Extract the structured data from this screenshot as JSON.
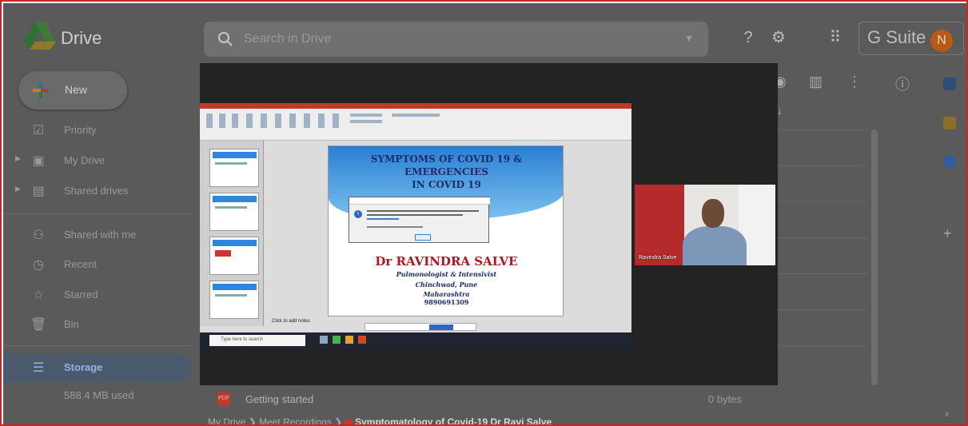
{
  "app": {
    "name": "Drive"
  },
  "search": {
    "placeholder": "Search in Drive"
  },
  "header": {
    "gsuite_label": "G Suite",
    "avatar_initial": "N"
  },
  "sidebar": {
    "new_label": "New",
    "items": [
      {
        "label": "Priority"
      },
      {
        "label": "My Drive"
      },
      {
        "label": "Shared drives"
      },
      {
        "label": "Shared with me"
      },
      {
        "label": "Recent"
      },
      {
        "label": "Starred"
      },
      {
        "label": "Bin"
      },
      {
        "label": "Storage"
      }
    ],
    "storage_used": "588.4 MB used"
  },
  "files": {
    "rows": [
      {
        "name": "Getting started",
        "size": "0 bytes"
      }
    ]
  },
  "breadcrumb": {
    "root": "My Drive",
    "folder": "Meet Recordings",
    "current": "Symptomatology of Covid-19 Dr Ravi Salve"
  },
  "video": {
    "slide_title_1": "SYMPTOMS OF COVID 19 & EMERGENCIES",
    "slide_title_2": "IN COVID 19",
    "doctor_name": "Dr RAVINDRA SALVE",
    "specialty": "Pulmonologist & Intensivist",
    "location_1": "Chinchwad, Pune",
    "location_2": "Maharashtra",
    "phone": "9890691309",
    "notes_label": "Click to add notes",
    "taskbar_search": "Type here to search",
    "participant_name": "Ravindra Salve"
  }
}
